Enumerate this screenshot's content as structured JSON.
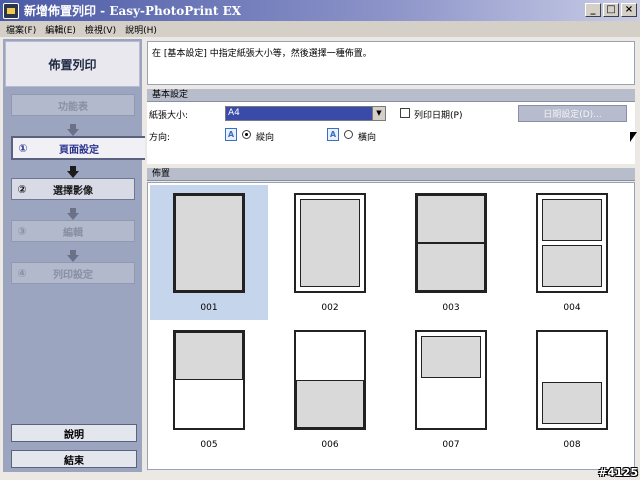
{
  "window": {
    "title": "新增佈置列印 - Easy-PhotoPrint EX",
    "minimize": "_",
    "maximize": "□",
    "close": "×"
  },
  "menu": [
    "檔案(F)",
    "編輯(E)",
    "檢視(V)",
    "說明(H)"
  ],
  "sidebar": {
    "header": "佈置列印",
    "steps": [
      {
        "num": "",
        "label": "功能表",
        "state": "disabled"
      },
      {
        "num": "①",
        "label": "頁面設定",
        "state": "active"
      },
      {
        "num": "②",
        "label": "選擇影像",
        "state": "enabled"
      },
      {
        "num": "③",
        "label": "編輯",
        "state": "disabled"
      },
      {
        "num": "④",
        "label": "列印設定",
        "state": "disabled"
      }
    ],
    "help_button": "說明",
    "exit_button": "結束"
  },
  "info_text": "在 [基本設定] 中指定紙張大小等，然後選擇一種佈置。",
  "basic_settings": {
    "section_title": "基本設定",
    "paper_size_label": "紙張大小:",
    "paper_size_value": "A4",
    "print_date_label": "列印日期(P)",
    "print_date_checked": false,
    "date_settings_button": "日期設定(D)...",
    "orientation_label": "方向:",
    "portrait_label": "縱向",
    "landscape_label": "橫向",
    "orientation_selected": "portrait"
  },
  "layout": {
    "section_title": "佈置",
    "selected": "001",
    "items": [
      "001",
      "002",
      "003",
      "004",
      "005",
      "006",
      "007",
      "008"
    ]
  },
  "watermark": "#4125",
  "icons": {
    "app": "app-printer-icon",
    "orientation_a": "orientation-a-icon",
    "step_arrow": "arrow-down-icon"
  },
  "colors": {
    "titlebar_start": "#4b5aa6",
    "sidebar_bg": "#9ca5c0",
    "selected_thumb": "#c5d5ec",
    "select_highlight": "#3a4aa8"
  }
}
